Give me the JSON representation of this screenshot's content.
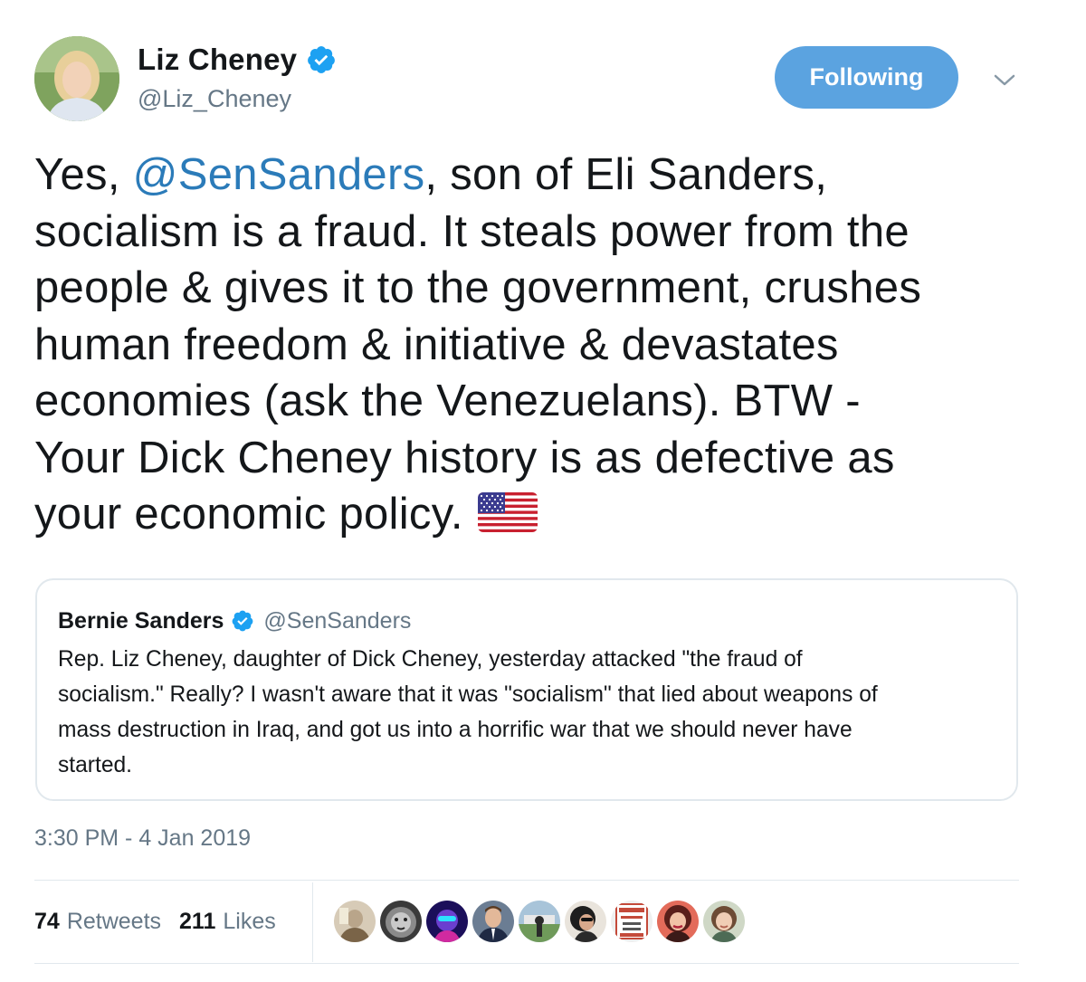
{
  "author": {
    "display_name": "Liz Cheney",
    "handle": "@Liz_Cheney",
    "verified": true,
    "avatar_icon": "profile-photo"
  },
  "follow_button": {
    "label": "Following",
    "color": "#5ba3e0"
  },
  "menu": {
    "icon": "chevron-down-icon"
  },
  "tweet": {
    "lines": [
      {
        "pre": "Yes, ",
        "mention": "@SenSanders",
        "post": ", son of Eli Sanders,"
      },
      {
        "text": "socialism is a fraud. It steals power from the"
      },
      {
        "text": "people & gives it to the government, crushes"
      },
      {
        "text": "human freedom & initiative & devastates"
      },
      {
        "text": "economies (ask the Venezuelans). BTW -"
      },
      {
        "text": "Your Dick Cheney history is as defective as"
      },
      {
        "text": "your economic policy."
      }
    ],
    "emoji": "us-flag-icon",
    "mention_color": "#2b7bb9"
  },
  "quoted_tweet": {
    "display_name": "Bernie Sanders",
    "handle": "@SenSanders",
    "verified": true,
    "lines": [
      "Rep. Liz Cheney, daughter of Dick Cheney, yesterday attacked \"the fraud of",
      "socialism.\" Really? I wasn't aware that it was \"socialism\" that lied about weapons of",
      "mass destruction in Iraq, and got us into a horrific war that we should never have",
      "started."
    ]
  },
  "timestamp": "3:30 PM - 4 Jan 2019",
  "stats": {
    "retweets_count": "74",
    "retweets_label": "Retweets",
    "likes_count": "211",
    "likes_label": "Likes"
  },
  "likers": [
    {
      "name": "liker-avatar-1",
      "color": "#b9a58a"
    },
    {
      "name": "liker-avatar-2",
      "color": "#4a4a4a"
    },
    {
      "name": "liker-avatar-3",
      "color": "#2a1e6e"
    },
    {
      "name": "liker-avatar-4",
      "color": "#6f5a4a"
    },
    {
      "name": "liker-avatar-5",
      "color": "#9cb7c9"
    },
    {
      "name": "liker-avatar-6",
      "color": "#2b2b2b"
    },
    {
      "name": "liker-avatar-7",
      "color": "#c44a3a",
      "text": "REDNECK NATION PARKING"
    },
    {
      "name": "liker-avatar-8",
      "color": "#c2574e"
    },
    {
      "name": "liker-avatar-9",
      "color": "#a98b73"
    }
  ],
  "colors": {
    "verified_blue": "#1da1f2",
    "secondary_text": "#657786",
    "border": "#e1e8ed"
  }
}
